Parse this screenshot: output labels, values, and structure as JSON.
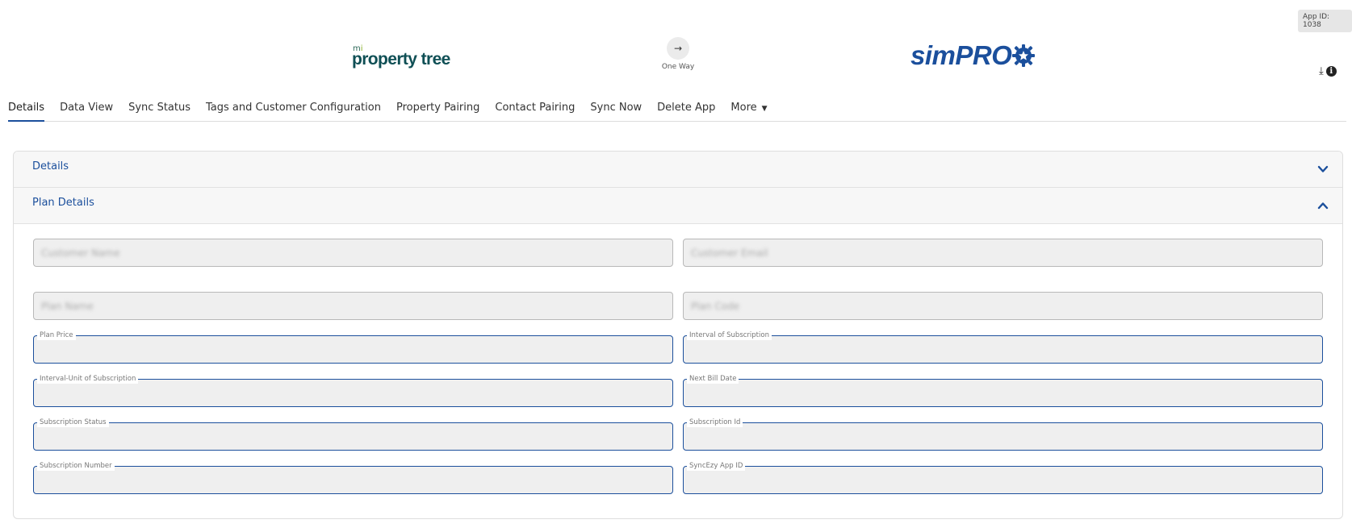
{
  "app_id": "App ID: 1038",
  "logos": {
    "source": {
      "prefix_m": "m",
      "prefix_i": "i",
      "name": "property tree"
    },
    "target": {
      "name": "simPRO"
    }
  },
  "sync": {
    "direction_label": "One Way",
    "icon": "arrow-right-icon"
  },
  "toolbar_icons": [
    "download-icon",
    "info-icon"
  ],
  "tabs": [
    {
      "label": "Details",
      "active": true
    },
    {
      "label": "Data View"
    },
    {
      "label": "Sync Status"
    },
    {
      "label": "Tags and Customer Configuration"
    },
    {
      "label": "Property Pairing"
    },
    {
      "label": "Contact Pairing"
    },
    {
      "label": "Sync Now"
    },
    {
      "label": "Delete App"
    },
    {
      "label": "More"
    }
  ],
  "sections": {
    "details": {
      "title": "Details",
      "expanded": false
    },
    "plan_details": {
      "title": "Plan Details",
      "expanded": true
    }
  },
  "fields": {
    "customer_name": {
      "placeholder": "Customer Name"
    },
    "customer_email": {
      "placeholder": "Customer Email"
    },
    "plan_name": {
      "placeholder": "Plan Name"
    },
    "plan_code": {
      "placeholder": "Plan Code"
    },
    "plan_price": {
      "label": "Plan Price",
      "value": ""
    },
    "interval_of_subscription": {
      "label": "Interval of Subscription",
      "value": ""
    },
    "interval_unit": {
      "label": "Interval-Unit of Subscription",
      "value": ""
    },
    "next_bill_date": {
      "label": "Next Bill Date",
      "value": ""
    },
    "subscription_status": {
      "label": "Subscription Status",
      "value": ""
    },
    "subscription_id": {
      "label": "Subscription Id",
      "value": ""
    },
    "subscription_number": {
      "label": "Subscription Number",
      "value": ""
    },
    "syncezy_app_id": {
      "label": "SyncEzy App ID",
      "value": ""
    }
  },
  "colors": {
    "accent": "#1b4f9c",
    "field_bg": "#efefef"
  }
}
